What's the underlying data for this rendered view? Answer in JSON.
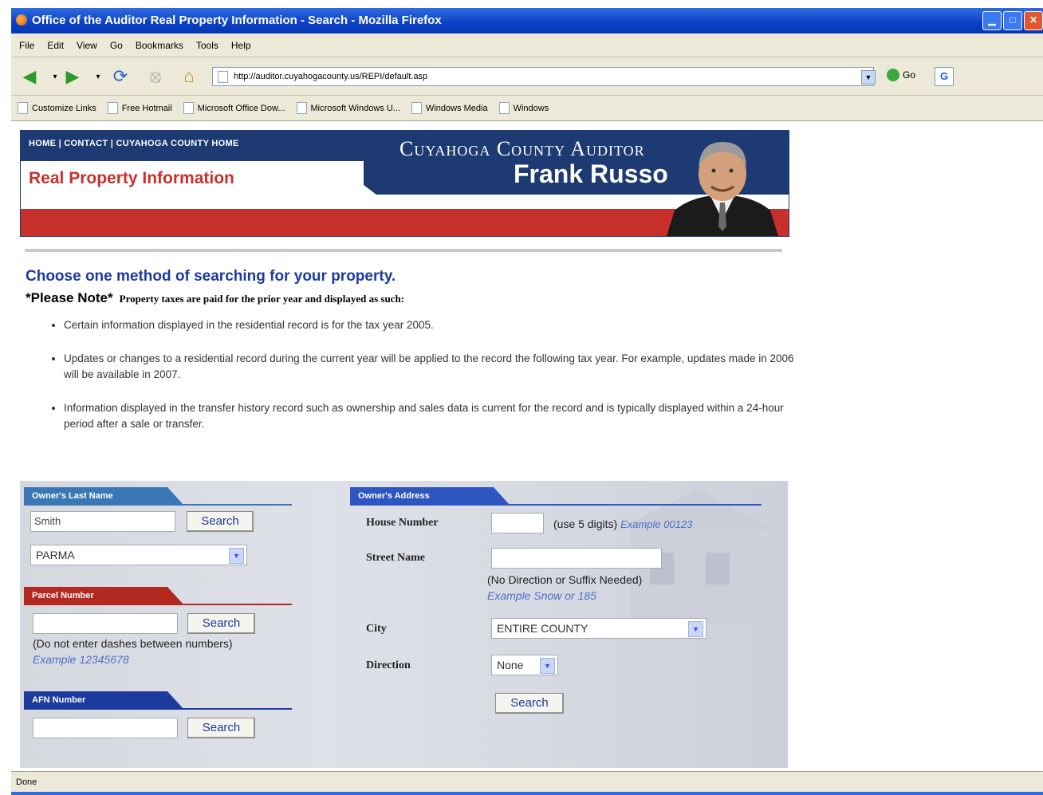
{
  "window": {
    "title": "Office of the Auditor Real Property Information - Search - Mozilla Firefox"
  },
  "menu": [
    "File",
    "Edit",
    "View",
    "Go",
    "Bookmarks",
    "Tools",
    "Help"
  ],
  "address": {
    "url": "http://auditor.cuyahogacounty.us/REPI/default.asp",
    "go_label": "Go"
  },
  "bookmarks": [
    "Customize Links",
    "Free Hotmail",
    "Microsoft Office Dow...",
    "Microsoft Windows U...",
    "Windows Media",
    "Windows"
  ],
  "banner": {
    "nav": [
      "HOME",
      "CONTACT",
      "CUYAHOGA COUNTY HOME"
    ],
    "title1": "Cuyahoga County Auditor",
    "title2": "Frank Russo",
    "section": "Real Property Information"
  },
  "intro": {
    "heading": "Choose one method of searching for your property.",
    "note_label": "*Please Note*",
    "note_text": "Property taxes are paid for the prior year and displayed as such:",
    "bullets": [
      "Certain information displayed in the residential record is for the tax year 2005.",
      "Updates or changes to a residential record during the current year will be applied to the record the following tax year. For example, updates made in 2006 will be available in 2007.",
      "Information displayed in the transfer history record such as ownership and sales data is current for the record and is typically displayed within a 24-hour period after a sale or transfer."
    ]
  },
  "owner_last_name": {
    "header": "Owner's Last Name",
    "value": "Smith",
    "search_label": "Search",
    "city_selected": "PARMA",
    "header_color": "#3a78b5"
  },
  "parcel": {
    "header": "Parcel Number",
    "value": "",
    "search_label": "Search",
    "hint": "(Do not enter dashes between numbers)",
    "example": "Example 12345678",
    "header_color": "#b3281f"
  },
  "afn": {
    "header": "AFN Number",
    "value": "",
    "search_label": "Search",
    "header_color": "#1d3a9f"
  },
  "address_search": {
    "header": "Owner's Address",
    "house_label": "House Number",
    "house_value": "",
    "house_hint": "(use 5 digits)",
    "house_example": "Example 00123",
    "street_label": "Street Name",
    "street_value": "",
    "street_hint": "(No Direction or Suffix Needed)",
    "street_example": "Example Snow or 185",
    "city_label": "City",
    "city_selected": "ENTIRE COUNTY",
    "direction_label": "Direction",
    "direction_selected": "None",
    "search_label": "Search",
    "header_color": "#2d56c0"
  },
  "status": {
    "text": "Done"
  }
}
